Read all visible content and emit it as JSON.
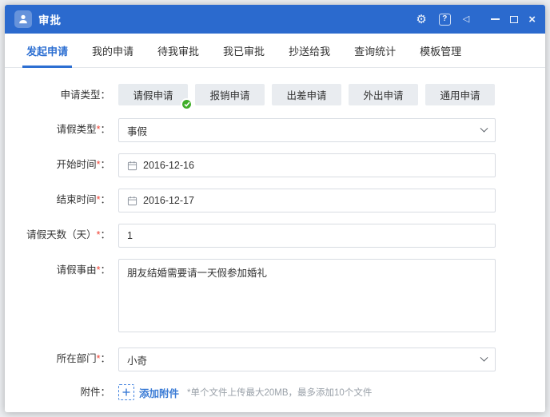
{
  "window": {
    "title": "审批"
  },
  "ui": {
    "required_mark": "*",
    "colon": "："
  },
  "colors": {
    "titlebar": "#2b6ace",
    "accent": "#2d6fd2",
    "success": "#3fae29",
    "required": "#f04134",
    "link": "#3a7bd5"
  },
  "tabs": [
    {
      "label": "发起申请",
      "active": true
    },
    {
      "label": "我的申请",
      "active": false
    },
    {
      "label": "待我审批",
      "active": false
    },
    {
      "label": "我已审批",
      "active": false
    },
    {
      "label": "抄送给我",
      "active": false
    },
    {
      "label": "查询统计",
      "active": false
    },
    {
      "label": "模板管理",
      "active": false
    }
  ],
  "form": {
    "apply_type": {
      "label": "申请类型",
      "options": [
        "请假申请",
        "报销申请",
        "出差申请",
        "外出申请",
        "通用申请"
      ],
      "selected": "请假申请"
    },
    "leave_type": {
      "label": "请假类型",
      "required": true,
      "value": "事假"
    },
    "start_date": {
      "label": "开始时间",
      "required": true,
      "value": "2016-12-16"
    },
    "end_date": {
      "label": "结束时间",
      "required": true,
      "value": "2016-12-17"
    },
    "days": {
      "label": "请假天数（天）",
      "required": true,
      "value": "1"
    },
    "reason": {
      "label": "请假事由",
      "required": true,
      "value": "朋友结婚需要请一天假参加婚礼"
    },
    "department": {
      "label": "所在部门",
      "required": true,
      "value": "小奇"
    },
    "attachment": {
      "label": "附件",
      "add_label": "添加附件",
      "hint": "*单个文件上传最大20MB，最多添加10个文件"
    }
  }
}
